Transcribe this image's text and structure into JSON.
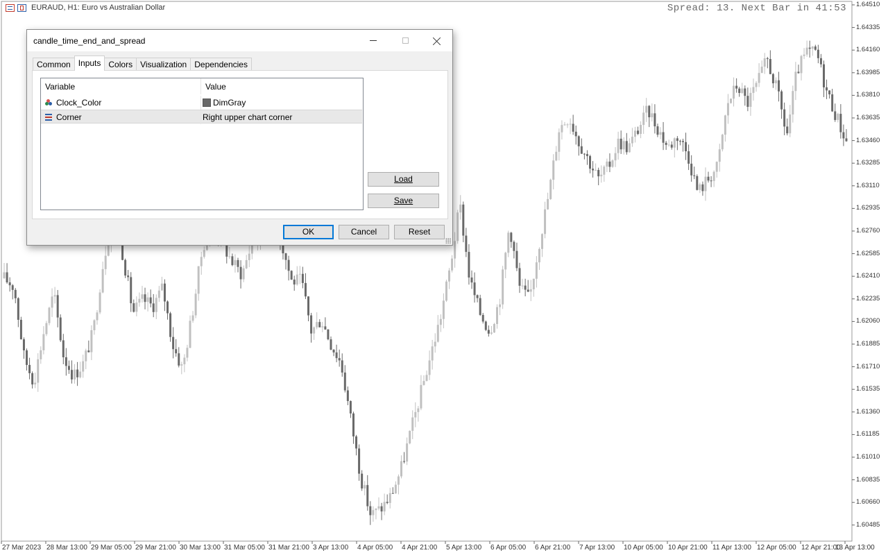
{
  "chart": {
    "title": "EURAUD, H1:  Euro vs Australian Dollar",
    "spread_text": "Spread: 13. Next Bar in 41:53",
    "price_labels": [
      "1.64510",
      "1.64335",
      "1.64160",
      "1.63985",
      "1.63810",
      "1.63635",
      "1.63460",
      "1.63285",
      "1.63110",
      "1.62935",
      "1.62760",
      "1.62585",
      "1.62410",
      "1.62235",
      "1.62060",
      "1.61885",
      "1.61710",
      "1.61535",
      "1.61360",
      "1.61185",
      "1.61010",
      "1.60835",
      "1.60660",
      "1.60485"
    ],
    "time_labels": [
      "27 Mar 2023",
      "28 Mar 13:00",
      "29 Mar 05:00",
      "29 Mar 21:00",
      "30 Mar 13:00",
      "31 Mar 05:00",
      "31 Mar 21:00",
      "3 Apr 13:00",
      "4 Apr 05:00",
      "4 Apr 21:00",
      "5 Apr 13:00",
      "6 Apr 05:00",
      "6 Apr 21:00",
      "7 Apr 13:00",
      "10 Apr 05:00",
      "10 Apr 21:00",
      "11 Apr 13:00",
      "12 Apr 05:00",
      "12 Apr 21:00",
      "13 Apr 13:00"
    ],
    "colors": {
      "bull": "#c0c0c0",
      "bear": "#696969",
      "axis": "#333333"
    }
  },
  "chart_data": {
    "type": "candlestick",
    "title": "EURAUD, H1:  Euro vs Australian Dollar",
    "ylim": [
      1.604,
      1.6455
    ],
    "close_path": [
      1.6242,
      1.6235,
      1.618,
      1.616,
      1.62,
      1.623,
      1.618,
      1.6165,
      1.6175,
      1.62,
      1.6255,
      1.6295,
      1.626,
      1.6215,
      1.6225,
      1.622,
      1.6235,
      1.619,
      1.617,
      1.6215,
      1.6265,
      1.629,
      1.627,
      1.6255,
      1.6245,
      1.627,
      1.6275,
      1.6285,
      1.627,
      1.624,
      1.624,
      1.62,
      1.621,
      1.619,
      1.6175,
      1.613,
      1.6085,
      1.6055,
      1.606,
      1.607,
      1.609,
      1.612,
      1.615,
      1.618,
      1.621,
      1.625,
      1.63,
      1.624,
      1.6215,
      1.62,
      1.6225,
      1.6285,
      1.6235,
      1.6225,
      1.627,
      1.631,
      1.636,
      1.637,
      1.635,
      1.6335,
      1.632,
      1.633,
      1.635,
      1.6345,
      1.636,
      1.6375,
      1.636,
      1.6345,
      1.6355,
      1.634,
      1.631,
      1.632,
      1.633,
      1.638,
      1.6395,
      1.638,
      1.6395,
      1.6415,
      1.639,
      1.6355,
      1.6405,
      1.642,
      1.642,
      1.639,
      1.637,
      1.635
    ]
  },
  "dialog": {
    "title": "candle_time_end_and_spread",
    "tabs": [
      "Common",
      "Inputs",
      "Colors",
      "Visualization",
      "Dependencies"
    ],
    "active_tab": "Inputs",
    "table": {
      "headers": [
        "Variable",
        "Value"
      ],
      "rows": [
        {
          "variable": "Clock_Color",
          "value": "DimGray",
          "swatch": "#696969",
          "icon": "palette-icon"
        },
        {
          "variable": "Corner",
          "value": "Right upper chart corner",
          "icon": "list-icon"
        }
      ]
    },
    "buttons": {
      "load": "Load",
      "save": "Save",
      "ok": "OK",
      "cancel": "Cancel",
      "reset": "Reset"
    }
  }
}
